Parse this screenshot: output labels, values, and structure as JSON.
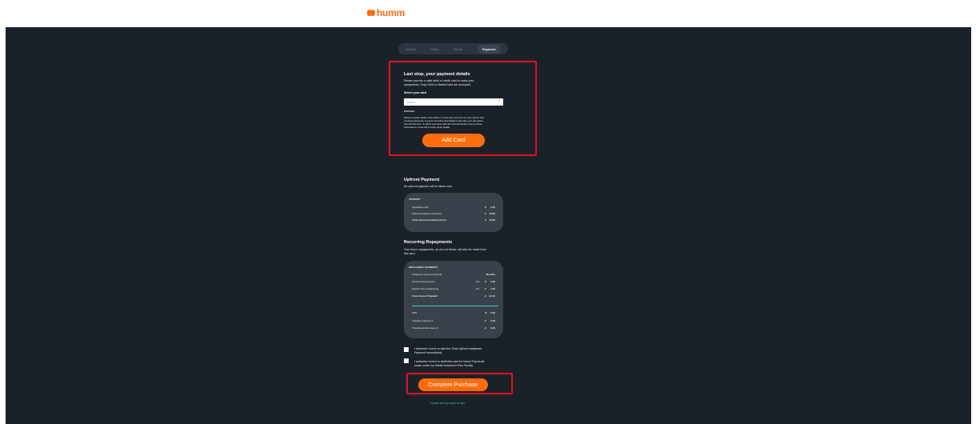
{
  "header": {
    "logo_text": "humm",
    "logo_icon": "humm-heart-icon"
  },
  "steps": [
    {
      "label": "Details",
      "active": false
    },
    {
      "label": "Plans",
      "active": false
    },
    {
      "label": "Terms",
      "active": false
    },
    {
      "label": "Payment",
      "active": true
    }
  ],
  "payment": {
    "title": "Last stop, your payment details",
    "description_line1": "Please provide a valid debit or credit card to make your",
    "description_line2": "repayments. Only VISA or MasterCard are accepted.",
    "select_label": "Select your card",
    "select_placeholder": "Select",
    "add_card_heading": "Add Card",
    "add_card_text_line1": "Please provide details of the debit or credit card you'll use for your upfront and",
    "add_card_text_line2": "recurring payments. If you've provided card details in the past, you can select",
    "add_card_text_line3": "from the list here. To add a new card, click the Add Card button and you'll be",
    "add_card_text_line4": "redirected to a new tab to enter those details.",
    "add_card_button": "Add Card"
  },
  "upfront": {
    "title": "Upfront Payment",
    "subtitle": "An upfront payment will be taken now.",
    "panel_heading": "UPFRONT",
    "rows": [
      {
        "label": "Application Fee",
        "currency": "€",
        "value": "0.00",
        "bold": false
      },
      {
        "label": "Upfront Instalment Payment",
        "currency": "€",
        "value": "16.50",
        "bold": false
      },
      {
        "label": "Total Upfront Instalment Pymt",
        "currency": "€",
        "value": "16.50",
        "bold": true
      }
    ]
  },
  "recurring": {
    "title": "Recurring Repayments",
    "subtitle_line1": "Your future repayments, as set out below, will also be made from",
    "subtitle_line2": "this card.",
    "panel_heading": "INSTALMENT PAYMENTS",
    "rows": [
      {
        "label": "Instalment Payment Interval",
        "mult": "",
        "currency": "",
        "value": "Monthly",
        "bold": false
      },
      {
        "label": "Account Keeping Fee",
        "mult": "2 x",
        "currency": "€",
        "value": "0.00",
        "bold": false
      },
      {
        "label": "Interest Free Instalments",
        "mult": "2 x",
        "currency": "€",
        "value": "2.50",
        "bold": false
      },
      {
        "label": "Total Amount Payable*",
        "mult": "",
        "currency": "€",
        "value": "21.50",
        "bold": true
      }
    ],
    "rows_bottom": [
      {
        "label": "APR",
        "currency": "%",
        "value": "0.00"
      },
      {
        "label": "*Includes interest of",
        "currency": "€",
        "value": "0.00"
      },
      {
        "label": "*Includes known Fees of",
        "currency": "€",
        "value": "0.00"
      }
    ]
  },
  "consents": {
    "consent1_line1": "I authorise humm to take the Total Upfront Instalment",
    "consent1_line2": "Payment Immediately",
    "consent2_line1": "I authorise humm to debit this card for future Payments",
    "consent2_line2": "made under my Retail Instalment Plan Facility"
  },
  "actions": {
    "complete_button": "Complete Purchase",
    "cancel_link": "Cancel and go back to cart"
  },
  "colors": {
    "accent": "#ff6c0e",
    "background": "#1b2129",
    "panel": "#3b414b",
    "highlight": "#e0121e",
    "teal": "#1ed4ad"
  }
}
